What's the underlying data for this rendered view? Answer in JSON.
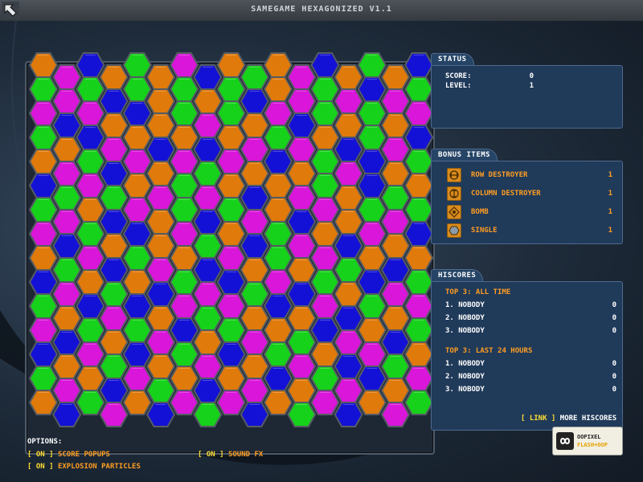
{
  "window": {
    "title": "SAMEGAME HEXAGONIZED V1.1"
  },
  "status": {
    "tab": "STATUS",
    "score_label": "SCORE:",
    "score": "0",
    "level_label": "LEVEL:",
    "level": "1"
  },
  "bonus": {
    "tab": "BONUS ITEMS",
    "items": [
      {
        "label": "ROW DESTROYER",
        "count": "1",
        "icon": "row-destroyer-icon"
      },
      {
        "label": "COLUMN DESTROYER",
        "count": "1",
        "icon": "column-destroyer-icon"
      },
      {
        "label": "BOMB",
        "count": "1",
        "icon": "bomb-icon"
      },
      {
        "label": "SINGLE",
        "count": "1",
        "icon": "single-icon"
      }
    ]
  },
  "hiscores": {
    "tab": "HISCORES",
    "all_time_title": "TOP 3: ALL TIME",
    "all_time": [
      {
        "name": "1. NOBODY",
        "score": "0"
      },
      {
        "name": "2. NOBODY",
        "score": "0"
      },
      {
        "name": "3. NOBODY",
        "score": "0"
      }
    ],
    "last24_title": "TOP 3: LAST 24 HOURS",
    "last24": [
      {
        "name": "1. NOBODY",
        "score": "0"
      },
      {
        "name": "2. NOBODY",
        "score": "0"
      },
      {
        "name": "3. NOBODY",
        "score": "0"
      }
    ],
    "link_label": "[ LINK ]",
    "more_label": "MORE HISCORES"
  },
  "options": {
    "title": "OPTIONS:",
    "score_popups": {
      "state": "[ ON ]",
      "label": "SCORE POPUPS"
    },
    "sound_fx": {
      "state": "[ ON ]",
      "label": "SOUND FX"
    },
    "explosion_particles": {
      "state": "[ ON ]",
      "label": "EXPLOSION PARTICLES"
    }
  },
  "logo": {
    "line1": "OOPIXEL",
    "line2": "FLASH+OOP"
  },
  "colors": {
    "orange": "#e07a0b",
    "green": "#16d21a",
    "magenta": "#d916d9",
    "blue": "#1411d6"
  },
  "board": {
    "columns": 17,
    "rows": 16,
    "cells": [
      "OMBOGOMBOGOMBOGOB",
      "GMGBGOGOGBOMGMBMG",
      "MBMOBOGMGOMBGOGOM",
      "GOBMOBOBOMGMOBGMB",
      "OMGBMOMGMOBOGMBOG",
      "BGMGOMGMOBOMGOBGO",
      "GMOBMOGBGMOBMOGMG",
      "MBGOBOMGOBGMOBMOB",
      "OGMBGMOBMOGOMGOBO",
      "BMOGOBGMBGMBGOBMG",
      "GOBMBOMGMOBOMBGOM",
      "MBGOGMBOGMOGBMOBG",
      "BOMGBOGMBOGMOBMGO",
      "GMOBMGOBOMBOGMBOM",
      "OBGMOBMGMBOGMBOMG",
      "GOMOBMGOMBGOMGOBM"
    ]
  }
}
